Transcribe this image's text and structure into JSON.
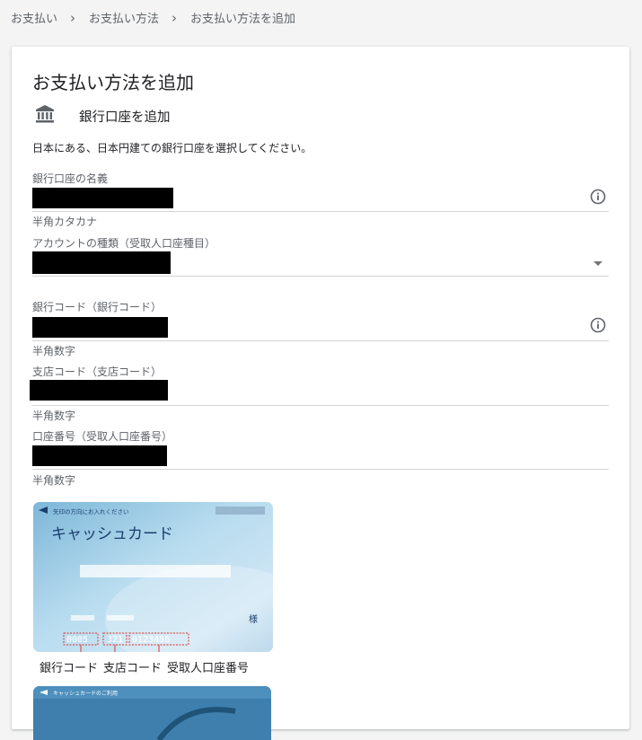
{
  "breadcrumb": {
    "items": [
      "お支払い",
      "お支払い方法",
      "お支払い方法を追加"
    ],
    "separator": "›"
  },
  "card": {
    "title": "お支払い方法を追加",
    "subtitle": "銀行口座を追加",
    "subtitle_icon": "bank-icon",
    "instruction": "日本にある、日本円建ての銀行口座を選択してください。"
  },
  "fields": {
    "account_name": {
      "label": "銀行口座の名義",
      "value": "",
      "helper": "半角カタカナ",
      "trailing_icon": "info-icon"
    },
    "account_type": {
      "label": "アカウントの種類（受取人口座種目）",
      "value": "",
      "trailing_icon": "dropdown-arrow-icon"
    },
    "bank_code": {
      "label": "銀行コード（銀行コード）",
      "value": "",
      "helper": "半角数字",
      "trailing_icon": "info-icon"
    },
    "branch_code": {
      "label": "支店コード（支店コード）",
      "value": "",
      "helper": "半角数字"
    },
    "account_number": {
      "label": "口座番号（受取人口座番号）",
      "value": "",
      "helper": "半角数字"
    }
  },
  "cash_card": {
    "top_text": "矢印の方向にお入れください",
    "card_title": "キャッシュカード",
    "sama": "様",
    "sample_bank_code": "0005",
    "sample_branch_code": "321",
    "sample_account_number": "0123456",
    "legend_bank": "銀行コード",
    "legend_branch": "支店コード",
    "legend_account": "受取人口座番号"
  },
  "cash_card_back": {
    "top_text": "キャッシュカードのご利用"
  },
  "colors": {
    "card_blue": "#8cc0dc",
    "card_text": "#1a3f6e",
    "sample_marker": "#d9534f"
  }
}
